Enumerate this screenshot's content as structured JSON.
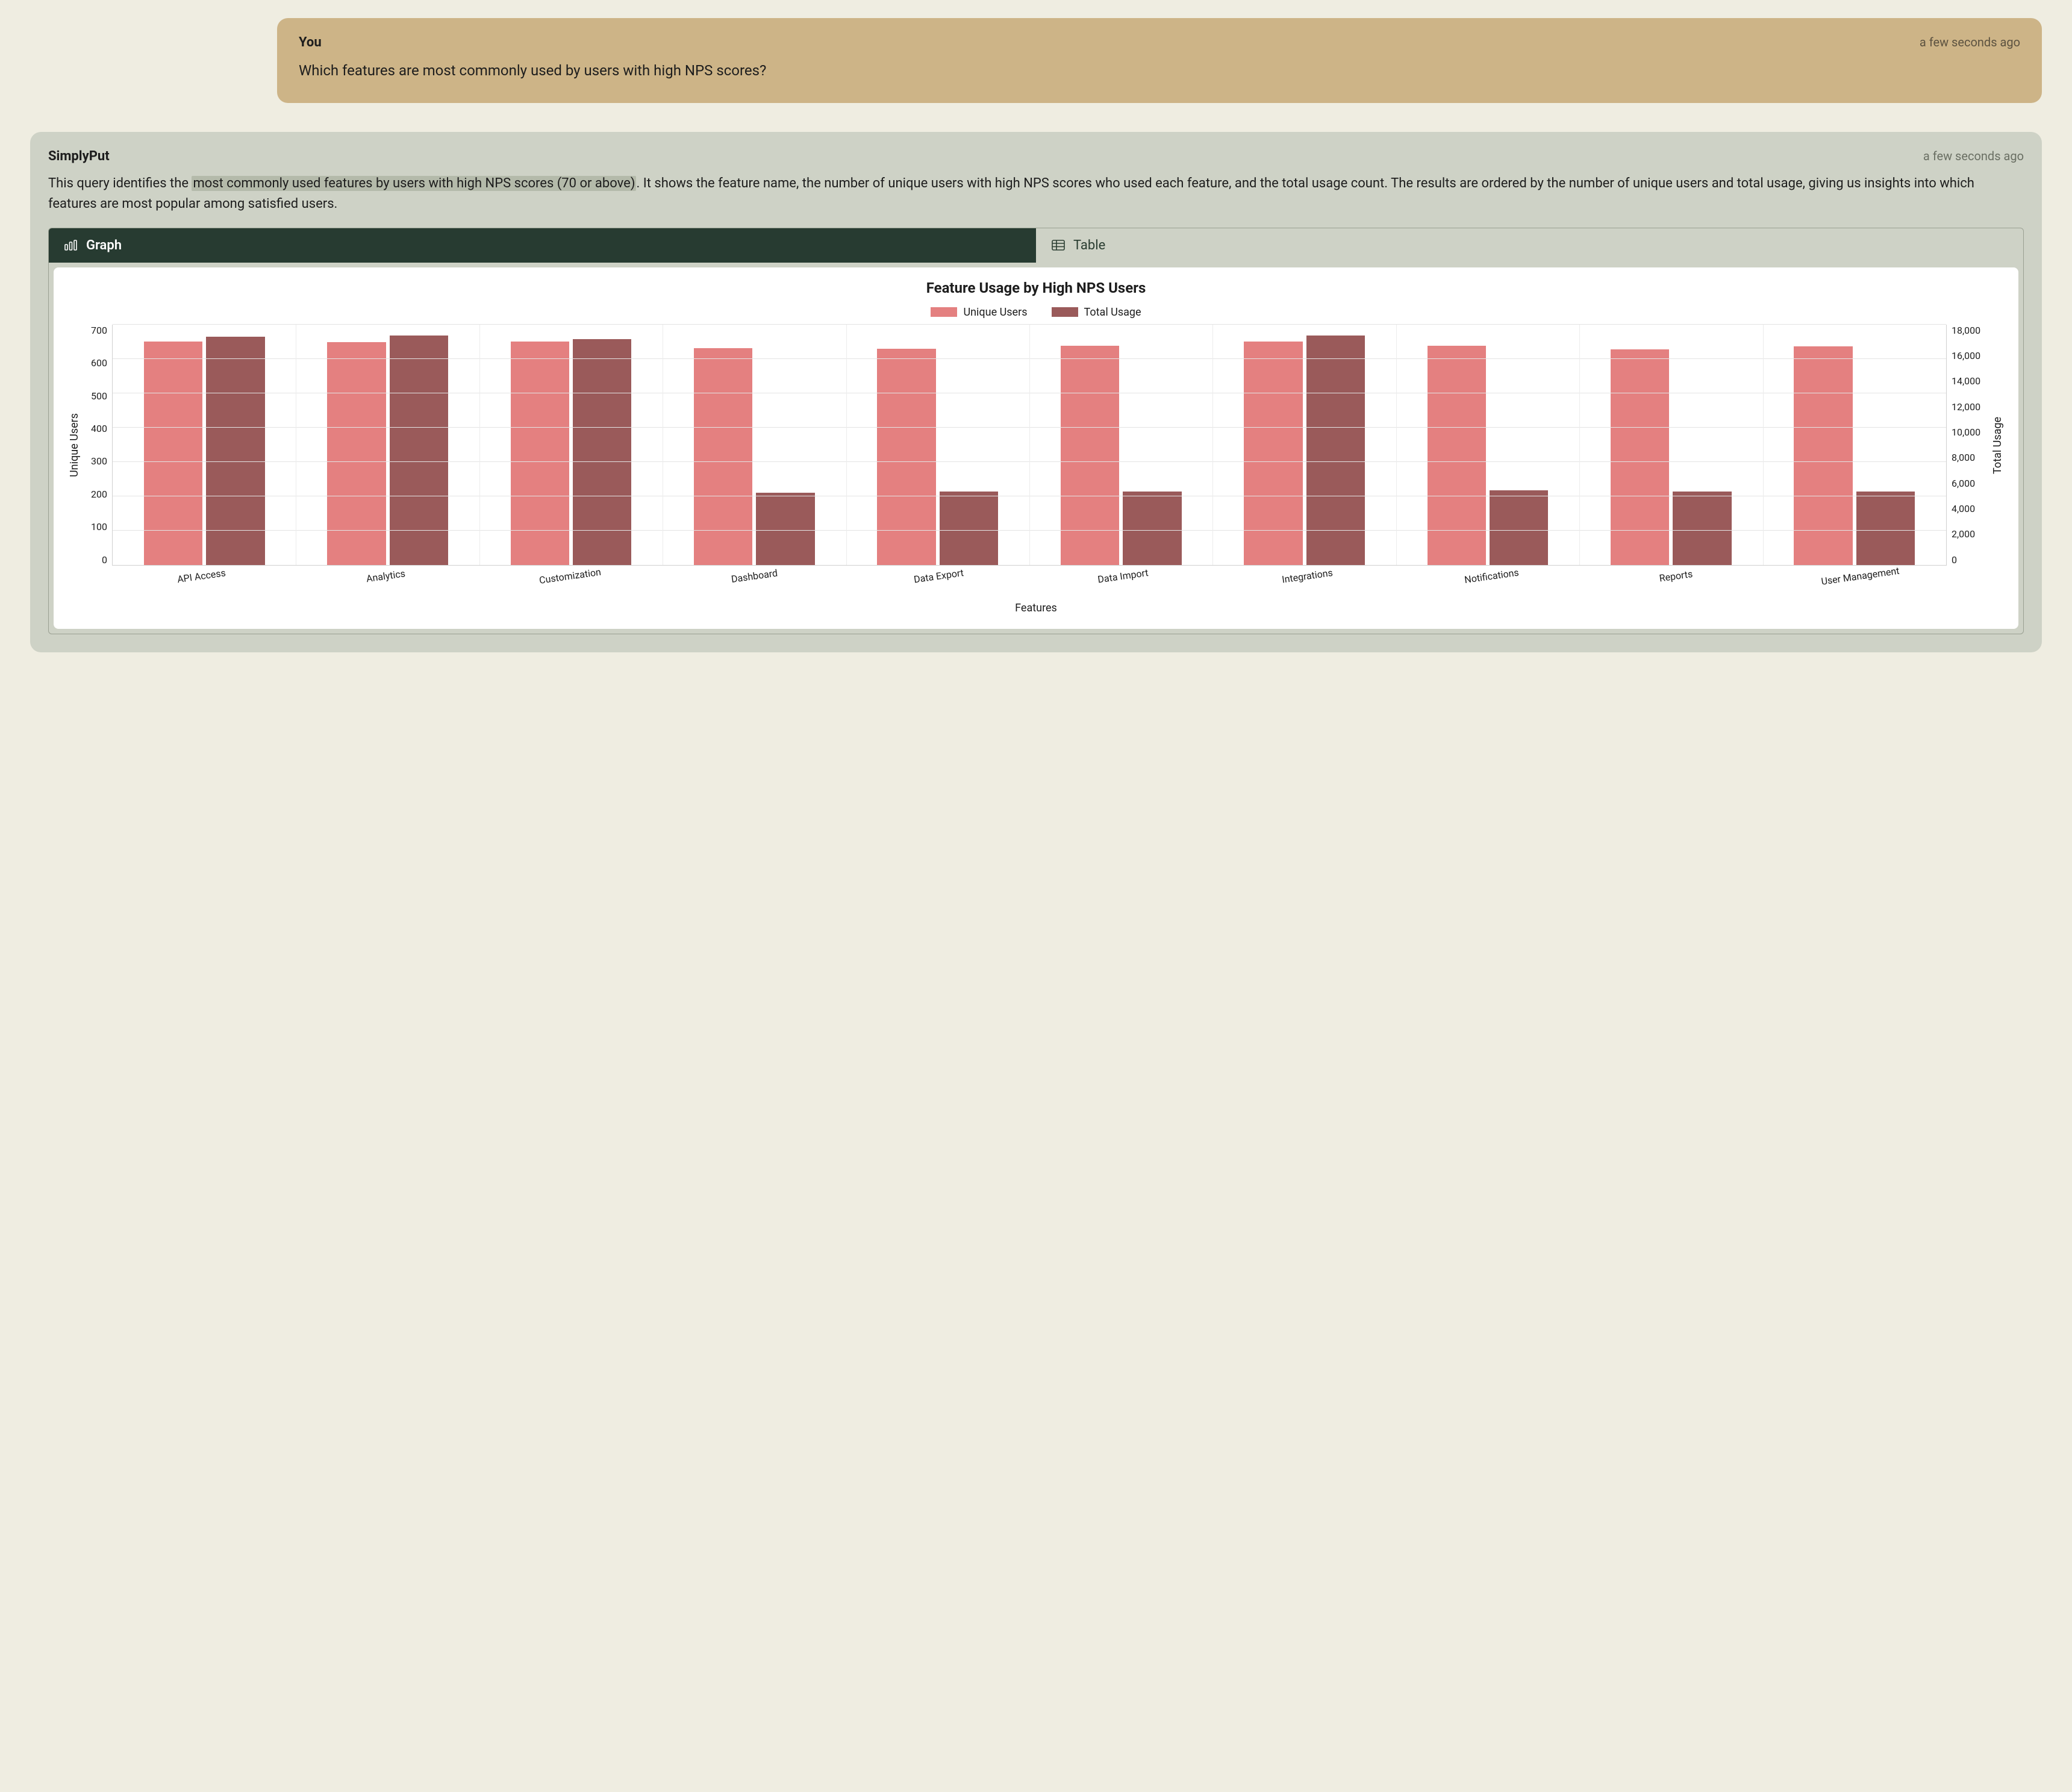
{
  "user_message": {
    "author": "You",
    "timestamp": "a few seconds ago",
    "text": "Which features are most commonly used by users with high NPS scores?"
  },
  "assistant_message": {
    "author": "SimplyPut",
    "timestamp": "a few seconds ago",
    "text_pre": "This query identifies the ",
    "text_hl": "most commonly used features by users with high NPS scores (70 or above)",
    "text_post": ". It shows the feature name, the number of unique users with high NPS scores who used each feature, and the total usage count. The results are ordered by the number of unique users and total usage, giving us insights into which features are most popular among satisfied users."
  },
  "tabs": {
    "graph": "Graph",
    "table": "Table"
  },
  "chart_data": {
    "type": "bar",
    "title": "Feature Usage by High NPS Users",
    "xlabel": "Features",
    "y_left_label": "Unique Users",
    "y_right_label": "Total Usage",
    "y_left_ticks": [
      0,
      100,
      200,
      300,
      400,
      500,
      600,
      700
    ],
    "y_right_ticks": [
      0,
      2000,
      4000,
      6000,
      8000,
      10000,
      12000,
      14000,
      16000,
      18000
    ],
    "y_right_tick_labels": [
      "0",
      "2,000",
      "4,000",
      "6,000",
      "8,000",
      "10,000",
      "12,000",
      "14,000",
      "16,000",
      "18,000"
    ],
    "y_left_lim": [
      0,
      700
    ],
    "y_right_lim": [
      0,
      18000
    ],
    "categories": [
      "API Access",
      "Analytics",
      "Customization",
      "Dashboard",
      "Data Export",
      "Data Import",
      "Integrations",
      "Notifications",
      "Reports",
      "User Management"
    ],
    "series": [
      {
        "name": "Unique Users",
        "axis": "left",
        "color": "#e48080",
        "values": [
          650,
          648,
          650,
          632,
          630,
          638,
          650,
          638,
          628,
          636
        ]
      },
      {
        "name": "Total Usage",
        "axis": "right",
        "color": "#9a5a5a",
        "values": [
          17100,
          17200,
          16900,
          5400,
          5500,
          5500,
          17200,
          5600,
          5500,
          5500
        ]
      }
    ]
  }
}
